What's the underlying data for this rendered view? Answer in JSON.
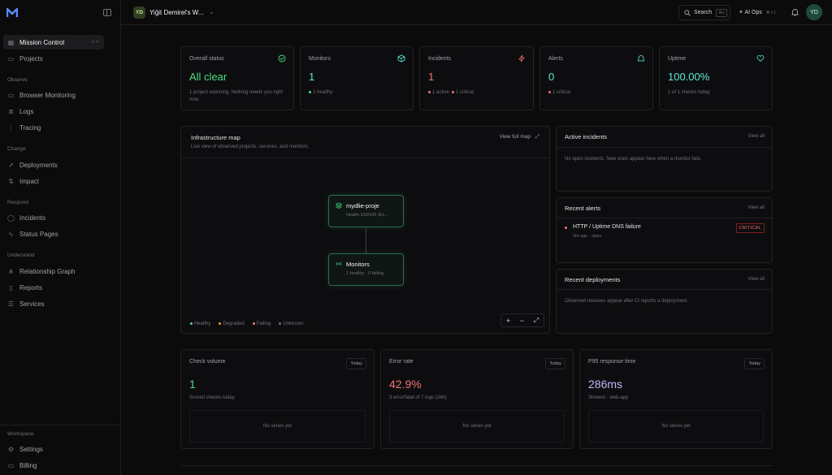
{
  "sidebar": {
    "items_top": [
      {
        "label": "Mission Control",
        "icon": "grid-icon",
        "kbd": "G H"
      },
      {
        "label": "Projects",
        "icon": "folder-icon"
      }
    ],
    "sections": [
      {
        "title": "Observe",
        "items": [
          {
            "label": "Browser Monitoring",
            "icon": "browser-icon"
          },
          {
            "label": "Logs",
            "icon": "logs-icon"
          },
          {
            "label": "Tracing",
            "icon": "tracing-icon"
          }
        ]
      },
      {
        "title": "Change",
        "items": [
          {
            "label": "Deployments",
            "icon": "rocket-icon"
          },
          {
            "label": "Impact",
            "icon": "impact-icon"
          }
        ]
      },
      {
        "title": "Respond",
        "items": [
          {
            "label": "Incidents",
            "icon": "alert-circle-icon"
          },
          {
            "label": "Status Pages",
            "icon": "activity-icon"
          }
        ]
      },
      {
        "title": "Understand",
        "items": [
          {
            "label": "Relationship Graph",
            "icon": "graph-icon"
          },
          {
            "label": "Reports",
            "icon": "document-icon"
          },
          {
            "label": "Services",
            "icon": "server-icon"
          }
        ]
      },
      {
        "title": "Workspace",
        "items": [
          {
            "label": "Settings",
            "icon": "gear-icon"
          },
          {
            "label": "Billing",
            "icon": "card-icon"
          }
        ]
      }
    ]
  },
  "topbar": {
    "workspace_initials": "YD",
    "workspace_name": "Yiğit Demirel's W...",
    "search_label": "Search",
    "search_kbd": "⌘K",
    "aiops_label": "AI Ops",
    "aiops_kbd": "⌘⇧J",
    "user_initials": "YD"
  },
  "stats": [
    {
      "label": "Overall status",
      "value": "All clear",
      "sub": "1 project watching. Nothing needs you right now.",
      "icon": "check-circle-icon",
      "color": "#4ade80"
    },
    {
      "label": "Monitors",
      "value": "1",
      "sub": "1 healthy",
      "icon": "cube-icon",
      "color": "#5eead4"
    },
    {
      "label": "Incidents",
      "value": "1",
      "sub1": "1 active",
      "sub2": "1 critical",
      "icon": "zap-icon",
      "color": "#f87171"
    },
    {
      "label": "Alerts",
      "value": "0",
      "sub": "1 critical",
      "icon": "bell-icon",
      "color": "#5eead4"
    },
    {
      "label": "Uptime",
      "value": "100.00%",
      "sub": "1 of 1 checks today",
      "icon": "heart-icon",
      "color": "#5eead4"
    }
  ],
  "infra": {
    "title": "Infrastructure map",
    "subtitle": "Live view of observed projects, services, and monitors.",
    "action": "View full map",
    "node1_title": "mydlie-proje",
    "node1_sub": "Health 100/100 (Ex...",
    "node2_title": "Monitors",
    "node2_sub": "1 healthy · 0 failing",
    "legend": [
      {
        "label": "Healthy",
        "color": "#4ade80"
      },
      {
        "label": "Degraded",
        "color": "#f59e0b"
      },
      {
        "label": "Failing",
        "color": "#f87171"
      },
      {
        "label": "Unknown",
        "color": "#71717a"
      }
    ],
    "zoom_in": "+",
    "zoom_out": "−",
    "fit": "⤢"
  },
  "active_incidents": {
    "title": "Active incidents",
    "action": "View all",
    "empty": "No open incidents. New ones appear here when a monitor fails."
  },
  "recent_alerts": {
    "title": "Recent alerts",
    "action": "View all",
    "alert_title": "HTTP / Uptime DNS failure",
    "alert_meta": "3m ago · open",
    "alert_badge": "CRITICAL"
  },
  "recent_deployments": {
    "title": "Recent deployments",
    "action": "View all",
    "empty": "Observed releases appear after CI reports a deployment."
  },
  "bottom": [
    {
      "label": "Check volume",
      "value": "1",
      "sub": "Scored checks today",
      "btn": "Today",
      "empty": "No series yet",
      "color": "#4ade80"
    },
    {
      "label": "Error rate",
      "value": "42.9%",
      "sub": "3 error/fatal of 7 logs (24h)",
      "btn": "Today",
      "empty": "No series yet",
      "color": "#f87171"
    },
    {
      "label": "P95 response time",
      "value": "286ms",
      "sub": "Slowest · web-app",
      "btn": "Today",
      "empty": "No series yet",
      "color": "#c4b5fd"
    }
  ]
}
